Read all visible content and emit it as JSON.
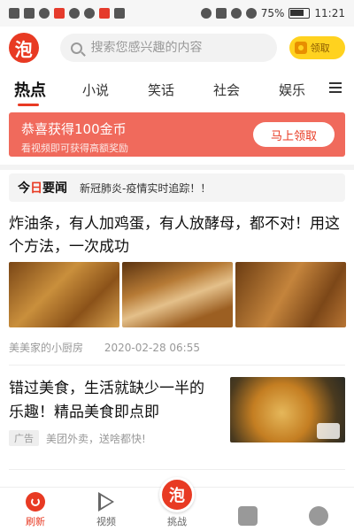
{
  "status_bar": {
    "battery": "75%",
    "time": "11:21"
  },
  "header": {
    "logo_text": "泡",
    "search_placeholder": "搜索您感兴趣的内容",
    "claim_label": "领取"
  },
  "tabs": [
    {
      "label": "热点",
      "active": true
    },
    {
      "label": "小说",
      "active": false
    },
    {
      "label": "笑话",
      "active": false
    },
    {
      "label": "社会",
      "active": false
    },
    {
      "label": "娱乐",
      "active": false
    }
  ],
  "promo": {
    "title": "恭喜获得100金币",
    "subtitle": "看视频即可获得高额奖励",
    "button": "马上领取"
  },
  "ticker": {
    "label_prefix": "今",
    "label_red": "日",
    "label_suffix": "要闻",
    "text": "新冠肺炎-疫情实时追踪！！"
  },
  "articles": [
    {
      "title": "炸油条，有人加鸡蛋，有人放酵母，都不对！用这个方法，一次成功",
      "source": "美美家的小厨房",
      "date": "2020-02-28 06:55"
    },
    {
      "title": "错过美食，生活就缺少一半的乐趣！精品美食即点即",
      "ad_tag": "广告",
      "source": "美团外卖，送啥都快!"
    }
  ],
  "bottom_nav": [
    {
      "label": "刷新",
      "active": true
    },
    {
      "label": "视频",
      "active": false
    },
    {
      "label": "挑战",
      "active": false
    },
    {
      "label": "",
      "active": false
    },
    {
      "label": "",
      "active": false
    }
  ],
  "colors": {
    "brand": "#e83a23",
    "promo_bg": "#f06a5c",
    "claim_pill": "#ffd21f"
  }
}
